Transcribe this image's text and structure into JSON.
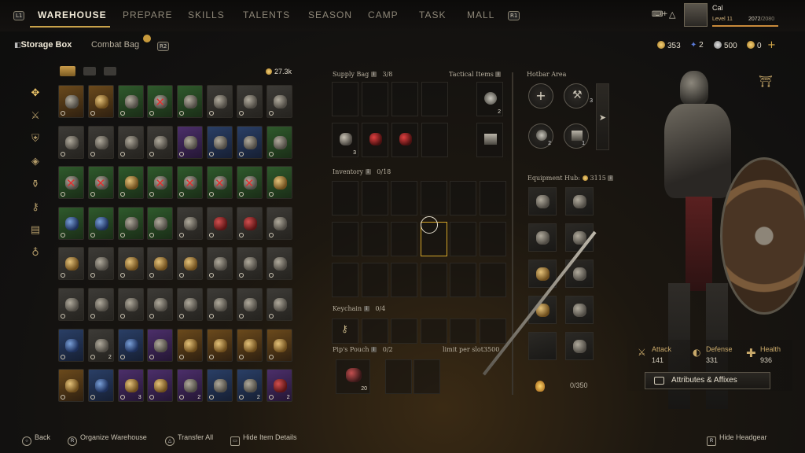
{
  "nav": {
    "left_badge": "L1",
    "right_badge": "R1",
    "tabs": [
      "WAREHOUSE",
      "PREPARE",
      "SKILLS",
      "TALENTS",
      "SEASON",
      "CAMP",
      "TASK",
      "MALL"
    ]
  },
  "player": {
    "name": "Cal",
    "level": "Level 11",
    "xp": "2072",
    "xp_max": "/2080",
    "xp_fraction": 0.996
  },
  "subheader": {
    "storage_tab": "Storage Box",
    "combat_tab": "Combat Bag",
    "combat_badge": "R2",
    "gold_amount": "27.3k"
  },
  "currencies": [
    {
      "value": "353"
    },
    {
      "value": "2"
    },
    {
      "value": "500"
    },
    {
      "value": "0"
    }
  ],
  "plus_symbol": "+",
  "grid_counts": {
    "r7c2": "2",
    "r8c3": "3",
    "r8c5": "2",
    "r8c7": "2",
    "r8c8": "2"
  },
  "supply": {
    "label": "Supply Bag",
    "count": "3/8",
    "tactical_label": "Tactical Items",
    "item_counts": [
      "3",
      "",
      ""
    ],
    "tactical_count": "2"
  },
  "inventory": {
    "label": "Inventory",
    "count": "0/18"
  },
  "keychain": {
    "label": "Keychain",
    "count": "0/4"
  },
  "pouch": {
    "label": "Pip's Pouch",
    "count": "0/2",
    "limit_text": "limit per slot",
    "limit_value": "3500",
    "item_count": "20"
  },
  "hotbar": {
    "label": "Hotbar Area",
    "counts": [
      "",
      "3",
      "2",
      "1"
    ]
  },
  "equipment": {
    "label": "Equipment Hub",
    "gold": "3115"
  },
  "capacity": "0/350",
  "stats": {
    "attack_label": "Attack",
    "attack_value": "141",
    "defense_label": "Defense",
    "defense_value": "331",
    "health_label": "Health",
    "health_value": "936",
    "attributes_button": "Attributes & Affixes"
  },
  "hints": {
    "back": "Back",
    "organize": "Organize Warehouse",
    "transfer": "Transfer All",
    "hide_details": "Hide Item Details",
    "hide_headgear": "Hide Headgear"
  },
  "colors": {
    "accent": "#c9a24a",
    "selection": "#d4a52a"
  }
}
